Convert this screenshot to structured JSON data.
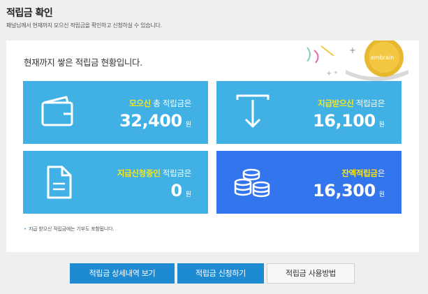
{
  "header": {
    "title": "적립금 확인",
    "description": "패널님께서 현재까지 모으신 적립금을 확인하고 신청하실 수 있습니다."
  },
  "panel": {
    "heading": "현재까지 쌓은 적립금 현황입니다.",
    "decoration_logo_text": "embrain"
  },
  "cards": [
    {
      "icon": "wallet-icon",
      "highlight": "모으신",
      "label_rest": " 총 적립금은",
      "amount": "32,400",
      "unit": "원"
    },
    {
      "icon": "download-arrow-icon",
      "highlight": "지급받으신",
      "label_rest": " 적립금은",
      "amount": "16,100",
      "unit": "원"
    },
    {
      "icon": "document-icon",
      "highlight": "지급신청중인",
      "label_rest": " 적립금은",
      "amount": "0",
      "unit": "원"
    },
    {
      "icon": "coins-stack-icon",
      "highlight": "잔액적립금",
      "label_rest": "은",
      "amount": "16,300",
      "unit": "원"
    }
  ],
  "note": "지급 받으신 적립금에는 기부도 포함됩니다.",
  "buttons": {
    "details": "적립금 상세내역 보기",
    "apply": "적립금 신청하기",
    "howto": "적립금 사용방법"
  },
  "colors": {
    "card_blue": "#41b0e4",
    "card_dark_blue": "#3275ec",
    "highlight_yellow": "#f8e71c",
    "button_blue": "#1d8ad2"
  }
}
